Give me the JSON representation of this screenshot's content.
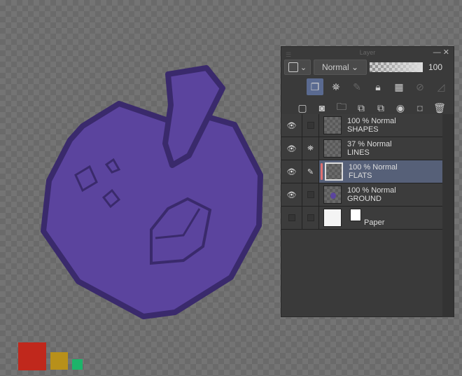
{
  "panel": {
    "title": "Layer",
    "blend_mode": "Normal",
    "opacity": "100"
  },
  "layers": [
    {
      "opacity": "100 % Normal",
      "name": "SHAPES",
      "visible": true
    },
    {
      "opacity": "37 % Normal",
      "name": "LINES",
      "visible": true
    },
    {
      "opacity": "100 % Normal",
      "name": "FLATS",
      "visible": true,
      "selected": true
    },
    {
      "opacity": "100 % Normal",
      "name": "GROUND",
      "visible": true
    },
    {
      "name": "Paper",
      "visible": false
    }
  ],
  "colors": {
    "fill": "#5b449e",
    "outline": "#3a2a6c",
    "swatch1": "#c0281c",
    "swatch2": "#b8901a",
    "swatch3": "#1db46a"
  }
}
